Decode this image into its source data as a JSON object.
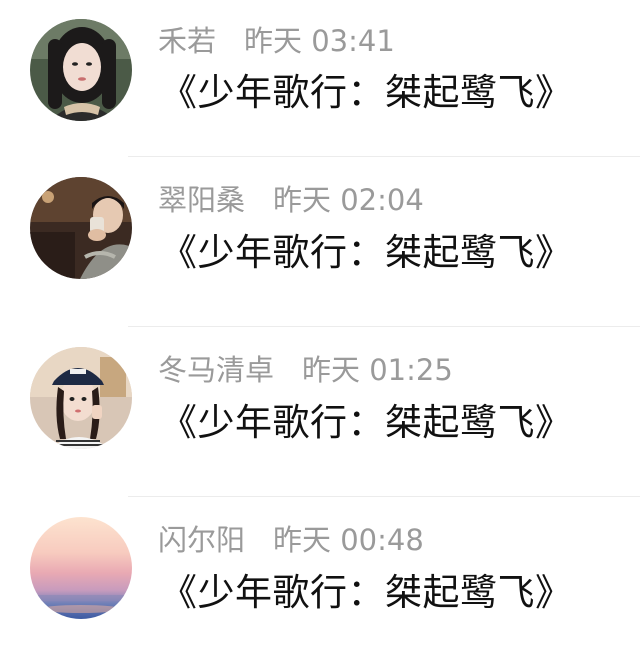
{
  "comments": [
    {
      "user": "禾若",
      "time": "昨天 03:41",
      "text": "《少年歌行：桀起鹭飞》",
      "avatar": "portrait-dark-hair-avatar"
    },
    {
      "user": "翠阳桑",
      "time": "昨天 02:04",
      "text": "《少年歌行：桀起鹭飞》",
      "avatar": "person-drinking-avatar"
    },
    {
      "user": "冬马清卓",
      "time": "昨天 01:25",
      "text": "《少年歌行：桀起鹭飞》",
      "avatar": "girl-with-cap-avatar"
    },
    {
      "user": "闪尔阳",
      "time": "昨天 00:48",
      "text": "《少年歌行：桀起鹭飞》",
      "avatar": "sunset-gradient-avatar"
    }
  ]
}
